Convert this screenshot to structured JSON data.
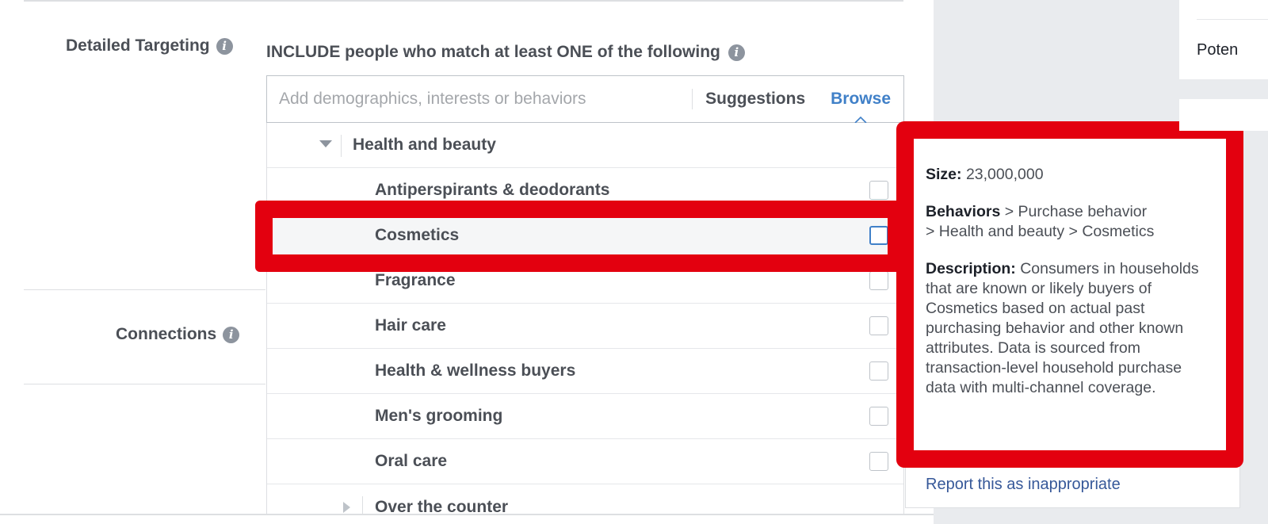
{
  "detailed_targeting": {
    "label": "Detailed Targeting",
    "include_text": "INCLUDE people who match at least ONE of the following",
    "search_placeholder": "Add demographics, interests or behaviors",
    "suggestions_label": "Suggestions",
    "browse_label": "Browse"
  },
  "connections": {
    "label": "Connections"
  },
  "dropdown": {
    "category": "Health and beauty",
    "items": [
      {
        "label": "Antiperspirants & deodorants",
        "checked": false
      },
      {
        "label": "Cosmetics",
        "checked": false,
        "highlighted": true
      },
      {
        "label": "Fragrance",
        "checked": false
      },
      {
        "label": "Hair care",
        "checked": false
      },
      {
        "label": "Health & wellness buyers",
        "checked": false
      },
      {
        "label": "Men's grooming",
        "checked": false
      },
      {
        "label": "Oral care",
        "checked": false
      }
    ],
    "next_category": "Over the counter"
  },
  "tooltip": {
    "size_label": "Size:",
    "size_value": "23,000,000",
    "path_head": "Behaviors",
    "path_line1": " > Purchase behavior",
    "path_line2": "> Health and beauty > Cosmetics",
    "description_label": "Description:",
    "description_text": "Consumers in households that are known or likely buyers of Cosmetics based on actual past purchasing behavior and other known attributes. Data is sourced from transaction-level household purchase data with multi-channel coverage.",
    "report_link": "Report this as inappropriate"
  },
  "right_panel": {
    "potential_text": "Poten"
  },
  "colors": {
    "highlight_red": "#e3000f",
    "link_blue": "#4080c8",
    "report_blue": "#365899"
  },
  "icons": {
    "info": "info-icon",
    "caret_down": "caret-down-icon",
    "caret_right": "caret-right-icon",
    "browse_caret": "chevron-up-icon"
  }
}
